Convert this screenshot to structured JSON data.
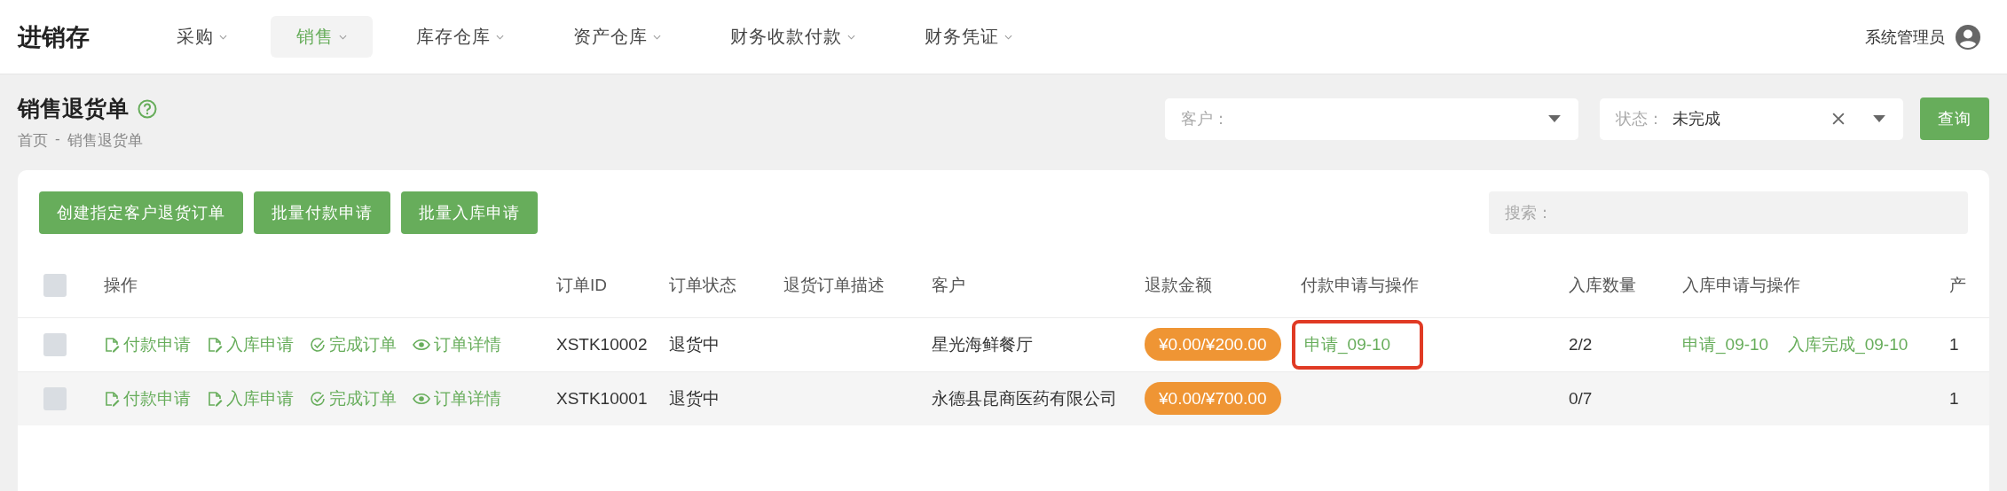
{
  "app_title": "进销存",
  "nav": [
    {
      "label": "采购",
      "selected": false
    },
    {
      "label": "销售",
      "selected": true
    },
    {
      "label": "库存仓库",
      "selected": false
    },
    {
      "label": "资产仓库",
      "selected": false
    },
    {
      "label": "财务收款付款",
      "selected": false
    },
    {
      "label": "财务凭证",
      "selected": false
    }
  ],
  "user": {
    "name": "系统管理员"
  },
  "page": {
    "title": "销售退货单",
    "breadcrumb": [
      "首页",
      "-",
      "销售退货单"
    ]
  },
  "filters": {
    "customer": {
      "label": "客户："
    },
    "status": {
      "label": "状态：",
      "value": "未完成"
    },
    "query_button": "查询"
  },
  "toolbar": {
    "buttons": [
      "创建指定客户退货订单",
      "批量付款申请",
      "批量入库申请"
    ],
    "search": {
      "placeholder": "搜索："
    }
  },
  "table": {
    "header_checked": false,
    "columns": [
      "操作",
      "订单ID",
      "订单状态",
      "退货订单描述",
      "客户",
      "退款金额",
      "付款申请与操作",
      "入库数量",
      "入库申请与操作",
      "产"
    ],
    "rows": [
      {
        "checked": false,
        "actions": [
          {
            "kind": "edit",
            "label": "付款申请"
          },
          {
            "kind": "edit",
            "label": "入库申请"
          },
          {
            "kind": "check",
            "label": "完成订单"
          },
          {
            "kind": "view",
            "label": "订单详情"
          }
        ],
        "order_id": "XSTK10002",
        "status": "退货中",
        "customer": "星光海鲜餐厅",
        "refund": "¥0.00/¥200.00",
        "payment_links": [
          "申请_09-10"
        ],
        "payment_highlighted": true,
        "stock_qty": "2/2",
        "stock_links": [
          "申请_09-10",
          "入库完成_09-10"
        ],
        "column_10": "1"
      },
      {
        "checked": false,
        "actions": [
          {
            "kind": "edit",
            "label": "付款申请"
          },
          {
            "kind": "edit",
            "label": "入库申请"
          },
          {
            "kind": "check",
            "label": "完成订单"
          },
          {
            "kind": "view",
            "label": "订单详情"
          }
        ],
        "order_id": "XSTK10001",
        "status": "退货中",
        "customer": "永德县昆商医药有限公司",
        "refund": "¥0.00/¥700.00",
        "payment_links": [],
        "payment_highlighted": false,
        "stock_qty": "0/7",
        "stock_links": [],
        "column_10": "1"
      }
    ]
  }
}
